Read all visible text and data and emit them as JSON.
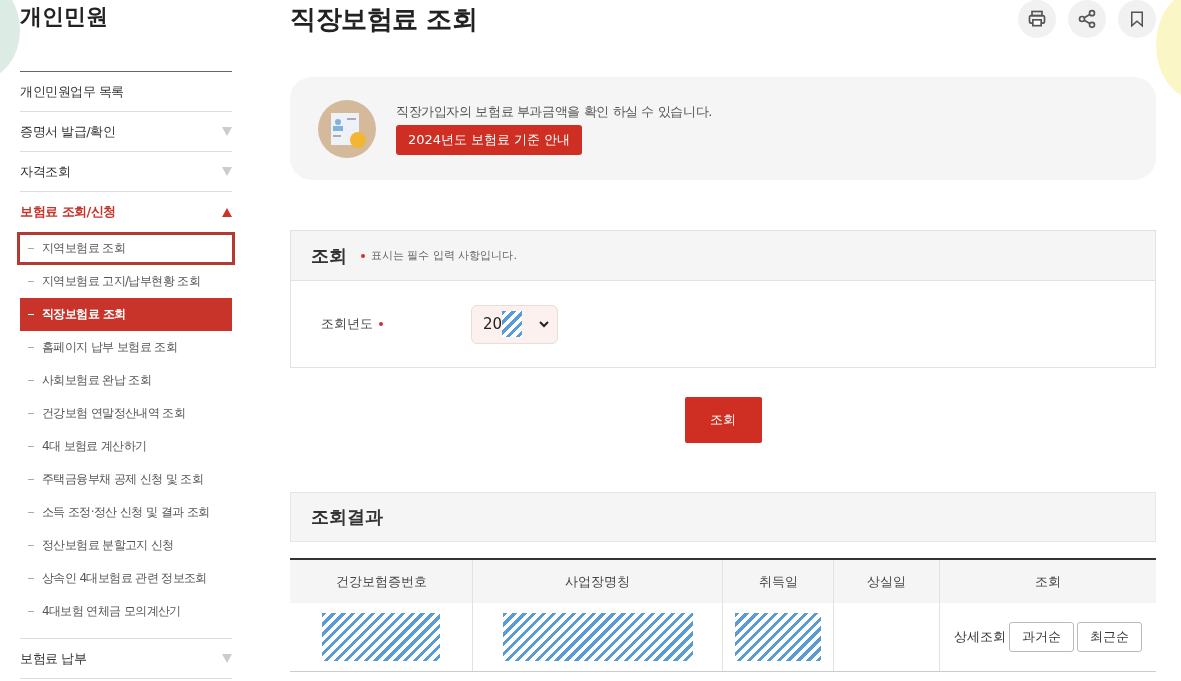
{
  "sidebar": {
    "title": "개인민원",
    "items": [
      {
        "label": "개인민원업무 목록",
        "kind": "link"
      },
      {
        "label": "증명서 발급/확인",
        "kind": "section",
        "expanded": false
      },
      {
        "label": "자격조회",
        "kind": "section",
        "expanded": false
      },
      {
        "label": "보험료 조회/신청",
        "kind": "section",
        "expanded": true,
        "children": [
          {
            "label": "지역보험료 조회",
            "selected": false,
            "focused": true
          },
          {
            "label": "지역보험료 고지/납부현황 조회",
            "selected": false,
            "focused": false
          },
          {
            "label": "직장보험료 조회",
            "selected": true,
            "focused": false
          },
          {
            "label": "홈페이지 납부 보험료 조회",
            "selected": false,
            "focused": false
          },
          {
            "label": "사회보험료 완납 조회",
            "selected": false,
            "focused": false
          },
          {
            "label": "건강보험 연말정산내역 조회",
            "selected": false,
            "focused": false
          },
          {
            "label": "4대 보험료 계산하기",
            "selected": false,
            "focused": false
          },
          {
            "label": "주택금융부채 공제 신청 및 조회",
            "selected": false,
            "focused": false
          },
          {
            "label": "소득 조정·정산 신청 및 결과 조회",
            "selected": false,
            "focused": false
          },
          {
            "label": "정산보험료 분할고지 신청",
            "selected": false,
            "focused": false
          },
          {
            "label": "상속인 4대보험료 관련 정보조회",
            "selected": false,
            "focused": false
          },
          {
            "label": "4대보험 연체금 모의계산기",
            "selected": false,
            "focused": false
          }
        ]
      },
      {
        "label": "보험료 납부",
        "kind": "section",
        "expanded": false
      }
    ]
  },
  "page": {
    "title": "직장보험료 조회"
  },
  "info": {
    "text": "직장가입자의 보험료 부과금액을 확인 하실 수 있습니다.",
    "button": "2024년도 보험료 기준 안내"
  },
  "search": {
    "title": "조회",
    "note": "표시는 필수 입력 사항입니다.",
    "field_label": "조회년도",
    "year_value": "20",
    "submit": "조회"
  },
  "results": {
    "title": "조회결과",
    "columns": [
      "건강보험증번호",
      "사업장명칭",
      "취득일",
      "상실일",
      "조회"
    ],
    "rows": [
      {
        "cells": [
          {
            "kind": "redacted"
          },
          {
            "kind": "redacted"
          },
          {
            "kind": "redacted"
          },
          {
            "kind": "empty"
          }
        ],
        "detail_label": "상세조회",
        "buttons": [
          "과거순",
          "최근순"
        ]
      }
    ]
  }
}
